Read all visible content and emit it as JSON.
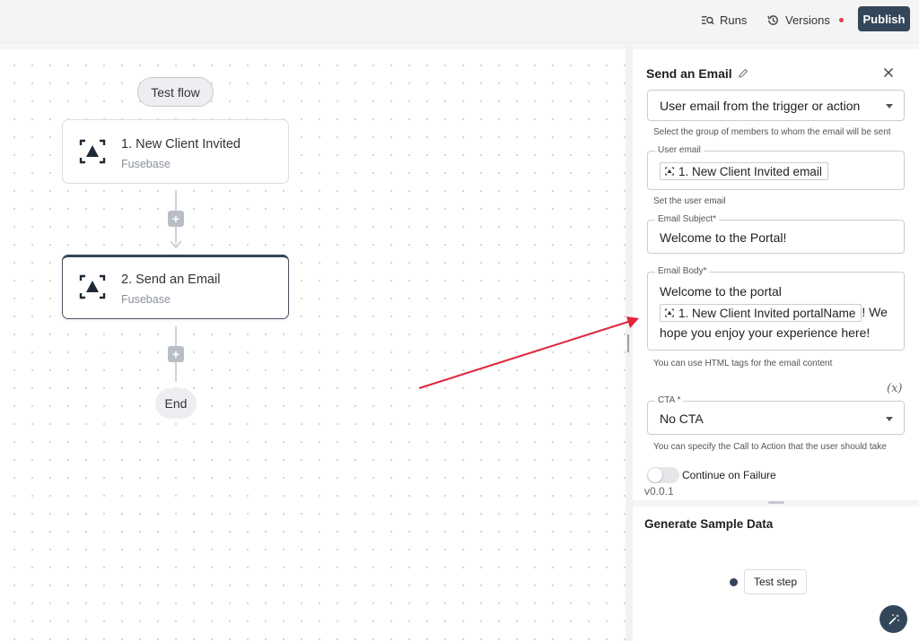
{
  "topbar": {
    "runs_label": "Runs",
    "versions_label": "Versions",
    "publish_label": "Publish"
  },
  "canvas": {
    "test_flow_label": "Test flow",
    "steps": [
      {
        "title": "1. New Client Invited",
        "subtitle": "Fusebase"
      },
      {
        "title": "2. Send an Email",
        "subtitle": "Fusebase"
      }
    ],
    "end_label": "End"
  },
  "panel": {
    "title": "Send an Email",
    "recipient_group": {
      "value": "User email from the trigger or action",
      "help": "Select the group of members to whom the email will be sent"
    },
    "user_email": {
      "label": "User email",
      "chip": "1. New Client Invited email",
      "help": "Set the user email"
    },
    "email_subject": {
      "label": "Email Subject*",
      "value": "Welcome to the Portal!"
    },
    "email_body": {
      "label": "Email Body*",
      "text_before": "Welcome to the portal",
      "chip": "1. New Client Invited portalName",
      "text_after": "! We hope you enjoy your experience here!",
      "help": "You can use HTML tags for the email content"
    },
    "variable_toggle": "(x)",
    "cta": {
      "label": "CTA *",
      "value": "No CTA",
      "help": "You can specify the Call to Action that the user should take"
    },
    "continue_on_failure": {
      "label": "Continue on Failure",
      "enabled": false
    },
    "version": "v0.0.1"
  },
  "sample_data": {
    "title": "Generate Sample Data",
    "test_step_label": "Test step"
  },
  "colors": {
    "primary": "#34475a",
    "annotation_arrow": "#e0263a",
    "badge_dot": "#e53e50"
  }
}
